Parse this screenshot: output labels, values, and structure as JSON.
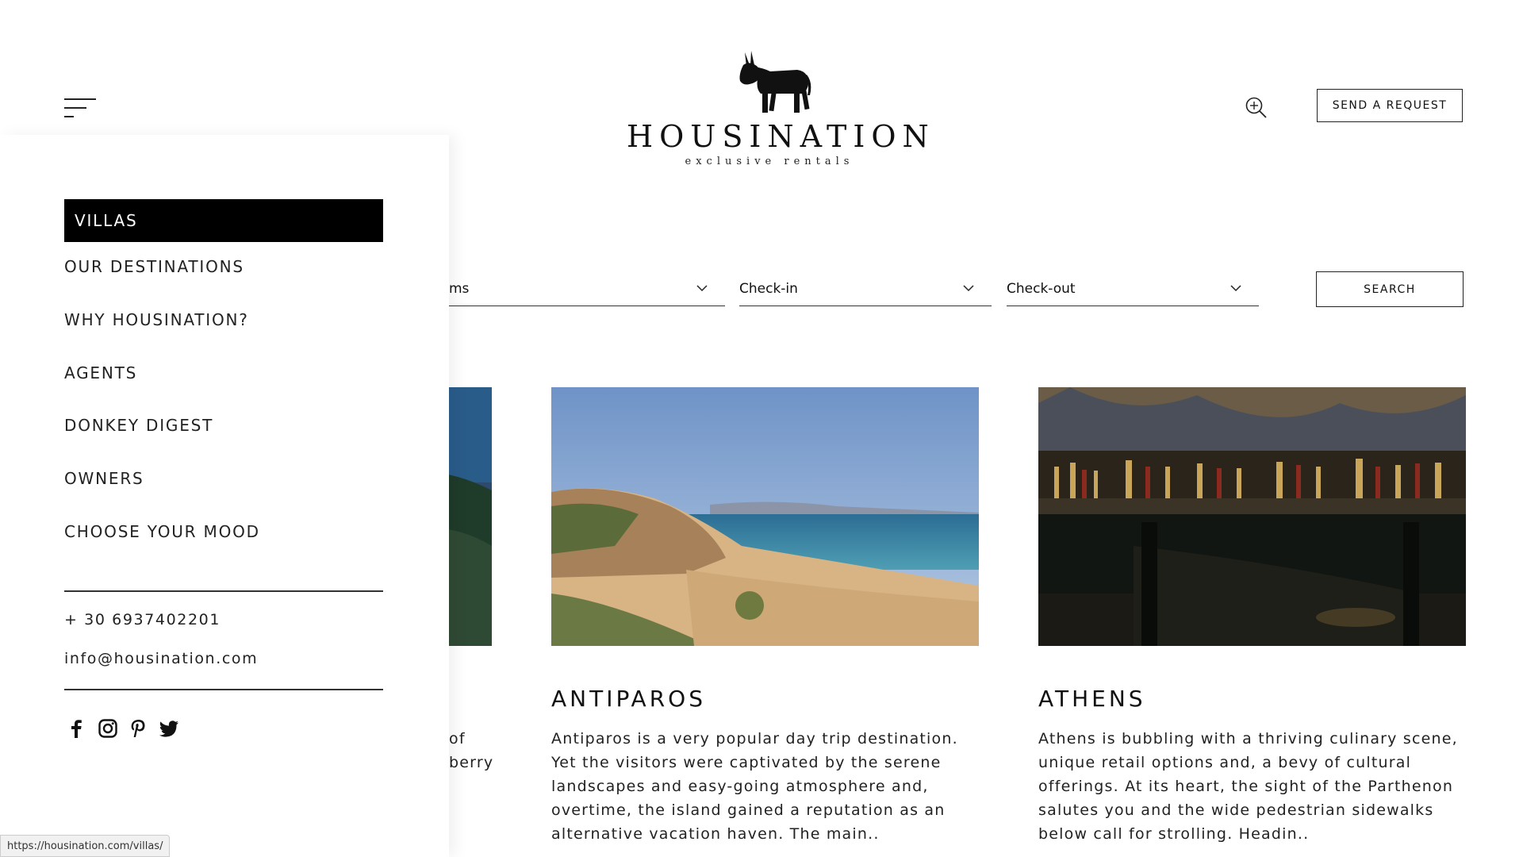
{
  "header": {
    "brand": "HOUSINATION",
    "tagline": "exclusive rentals",
    "send_request": "SEND A REQUEST"
  },
  "search": {
    "rooms_label": "ms",
    "checkin_label": "Check-in",
    "checkout_label": "Check-out",
    "button": "SEARCH"
  },
  "cards": [
    {
      "title": "",
      "text_fragments": [
        "of",
        "berry"
      ]
    },
    {
      "title": "ANTIPAROS",
      "text": "Antiparos is a very popular day trip destination. Yet the visitors were captivated by the serene landscapes and easy-going atmosphere and, overtime, the island gained a reputation as an alternative vacation haven. The main.."
    },
    {
      "title": "ATHENS",
      "text": "Athens is bubbling with a thriving culinary scene, unique retail options and, a bevy of cultural offerings. At its heart, the sight of the Parthenon salutes you and the wide pedestrian sidewalks below call for strolling. Headin.."
    }
  ],
  "menu": {
    "items": [
      {
        "label": "VILLAS",
        "active": true
      },
      {
        "label": "OUR DESTINATIONS"
      },
      {
        "label": "WHY HOUSINATION?"
      },
      {
        "label": "AGENTS"
      },
      {
        "label": "DONKEY DIGEST"
      },
      {
        "label": "OWNERS"
      },
      {
        "label": "CHOOSE YOUR MOOD"
      }
    ],
    "phone": "+ 30 6937402201",
    "email": "info@housination.com",
    "social": [
      "facebook-icon",
      "instagram-icon",
      "pinterest-icon",
      "twitter-icon"
    ]
  },
  "status_url": "https://housination.com/villas/"
}
